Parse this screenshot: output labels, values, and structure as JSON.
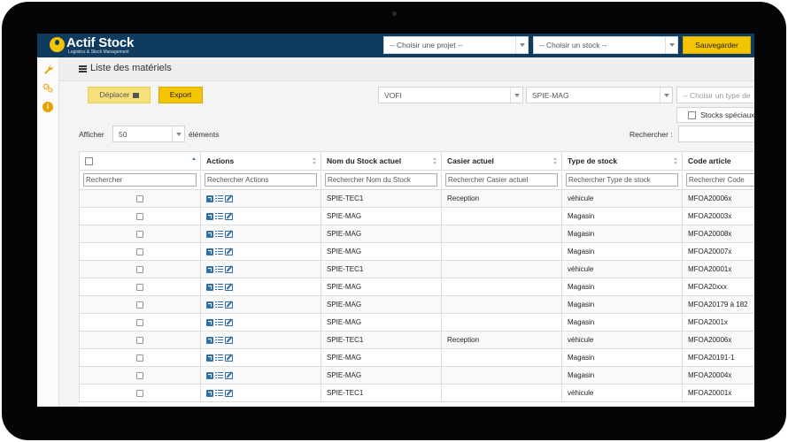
{
  "app": {
    "logo_text": "Actif Stock",
    "logo_subtitle": "Logistics & Stock Management",
    "project_select": "-- Choisir une projet --",
    "stock_select": "-- Choisir un stock --",
    "save_label": "Sauvegarder"
  },
  "colors": {
    "topbar": "#0f3b5f",
    "accent": "#f5c400",
    "icon_blue": "#2f6fb0",
    "sidebar_icon": "#e8a200"
  },
  "sidebar": {
    "icons": [
      "wrench-icon",
      "cogs-icon",
      "info-icon"
    ]
  },
  "page": {
    "title": "Liste des matériels"
  },
  "toolbar": {
    "move_label": "Déplacer",
    "export_label": "Export",
    "filter_vofi": "VOFI",
    "filter_spie": "SPIE-MAG",
    "filter_type_placeholder": "-- Choisir un type de",
    "special_stock_label": "Stocks spéciaux"
  },
  "length": {
    "show_label": "Afficher",
    "value": "50",
    "elements_label": "éléments"
  },
  "search": {
    "label": "Rechercher :"
  },
  "table": {
    "columns": [
      "",
      "Actions",
      "Nom du Stock actuel",
      "Casier actuel",
      "Type de stock",
      "Code article"
    ],
    "filters": [
      "Rechercher",
      "Rechercher Actions",
      "Rechercher Nom du Stock",
      "Rechercher Casier actuel",
      "Rechercher Type de stock",
      "Rechercher Code"
    ],
    "rows": [
      {
        "stock": "SPIE-TEC1",
        "casier": "Reception",
        "type": "véhicule",
        "code": "MFOA20006x"
      },
      {
        "stock": "SPIE-MAG",
        "casier": "",
        "type": "Magasin",
        "code": "MFOA20003x"
      },
      {
        "stock": "SPIE-MAG",
        "casier": "",
        "type": "Magasin",
        "code": "MFOA20008x"
      },
      {
        "stock": "SPIE-MAG",
        "casier": "",
        "type": "Magasin",
        "code": "MFOA20007x"
      },
      {
        "stock": "SPIE-TEC1",
        "casier": "",
        "type": "véhicule",
        "code": "MFOA20001x"
      },
      {
        "stock": "SPIE-MAG",
        "casier": "",
        "type": "Magasin",
        "code": "MFOA20xxx"
      },
      {
        "stock": "SPIE-MAG",
        "casier": "",
        "type": "Magasin",
        "code": "MFOA20179 à 182"
      },
      {
        "stock": "SPIE-MAG",
        "casier": "",
        "type": "Magasin",
        "code": "MFOA2001x"
      },
      {
        "stock": "SPIE-TEC1",
        "casier": "Reception",
        "type": "véhicule",
        "code": "MFOA20006x"
      },
      {
        "stock": "SPIE-MAG",
        "casier": "",
        "type": "Magasin",
        "code": "MFOA20191-1"
      },
      {
        "stock": "SPIE-MAG",
        "casier": "",
        "type": "Magasin",
        "code": "MFOA20004x"
      },
      {
        "stock": "SPIE-TEC1",
        "casier": "",
        "type": "véhicule",
        "code": "MFOA20001x"
      }
    ]
  }
}
